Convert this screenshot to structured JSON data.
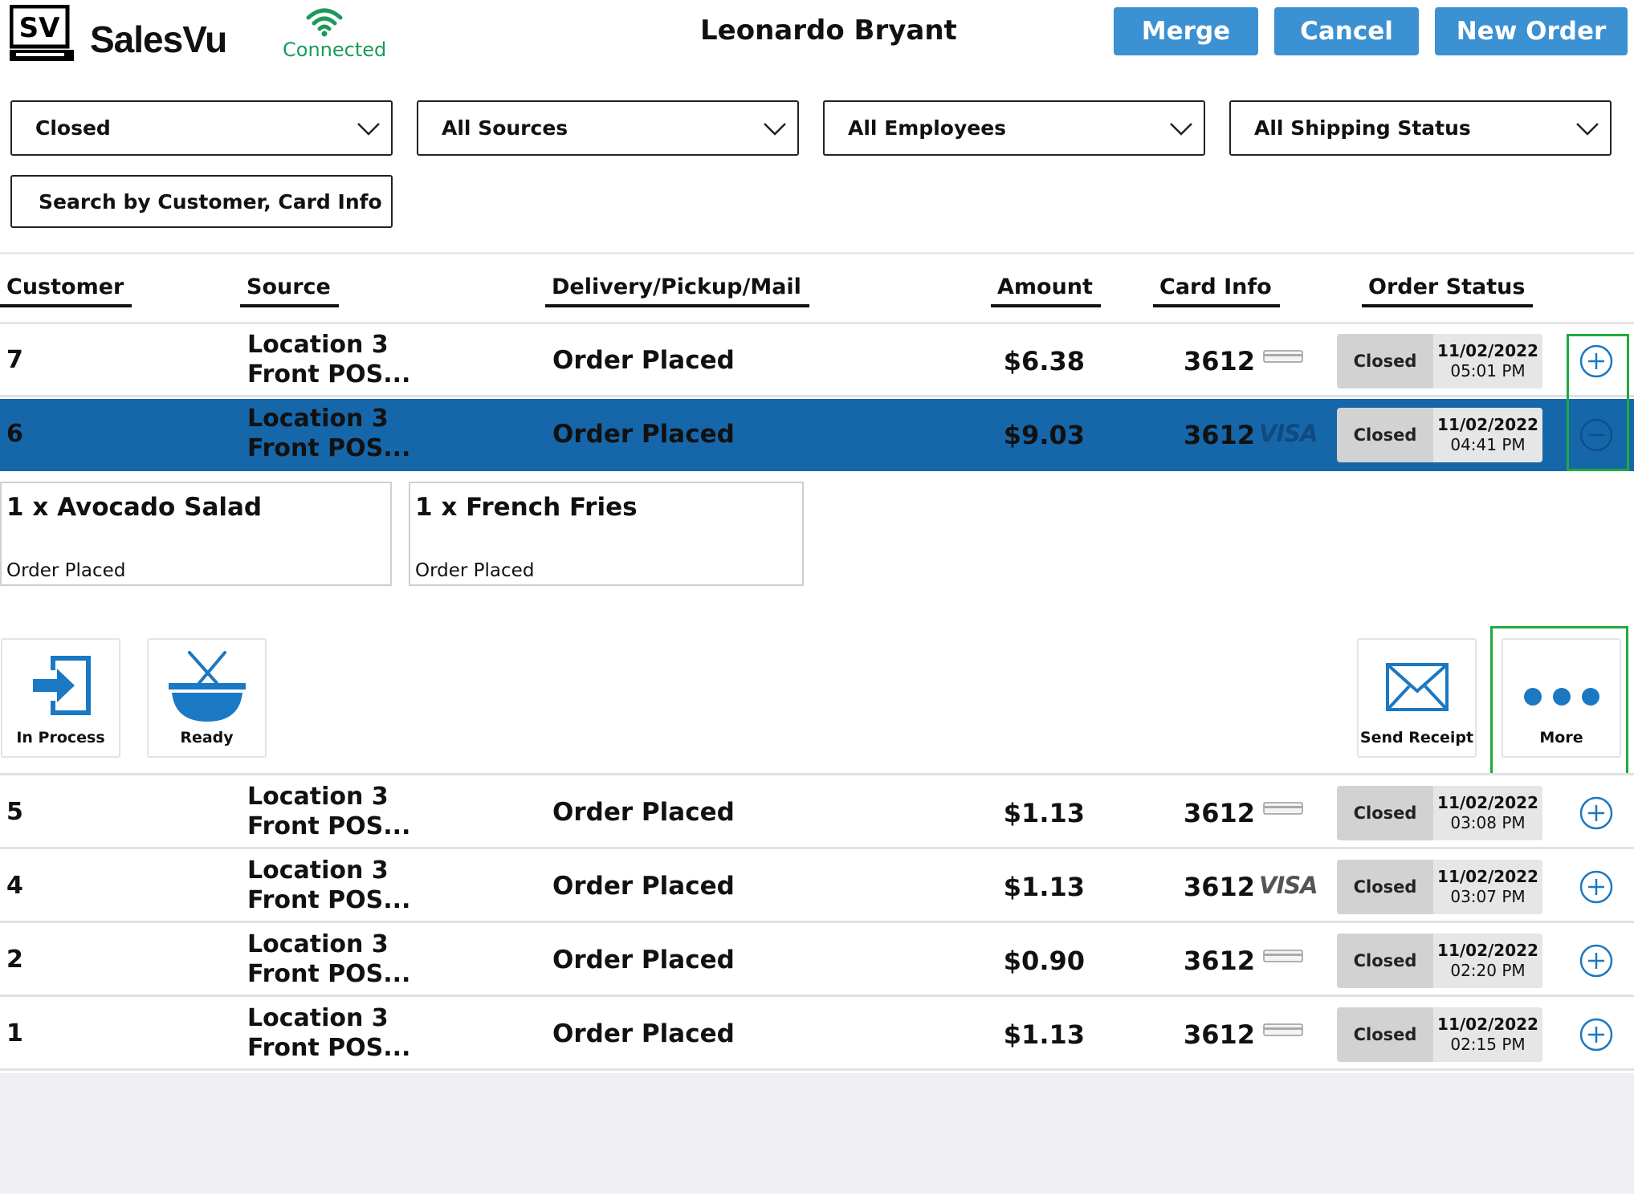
{
  "app": {
    "brand": "SalesVu",
    "logo_text": "SV",
    "connection_status": "Connected",
    "user_name": "Leonardo Bryant"
  },
  "header_buttons": {
    "merge": "Merge",
    "cancel": "Cancel",
    "new_order": "New Order"
  },
  "filters": {
    "status": "Closed",
    "sources": "All Sources",
    "employees": "All Employees",
    "shipping": "All Shipping Status",
    "search_placeholder": "Search by Customer, Card Info"
  },
  "columns": {
    "customer": "Customer",
    "source": "Source",
    "delivery": "Delivery/Pickup/Mail",
    "amount": "Amount",
    "card_info": "Card Info",
    "order_status": "Order Status"
  },
  "orders": [
    {
      "customer": "7",
      "source_line1": "Location 3",
      "source_line2": "Front POS...",
      "delivery": "Order Placed",
      "amount": "$6.38",
      "card": "3612",
      "card_type": "generic-card-icon",
      "status": "Closed",
      "date": "11/02/2022",
      "time": "05:01 PM",
      "expanded": false
    },
    {
      "customer": "6",
      "source_line1": "Location 3",
      "source_line2": "Front POS...",
      "delivery": "Order Placed",
      "amount": "$9.03",
      "card": "3612",
      "card_type": "VISA",
      "status": "Closed",
      "date": "11/02/2022",
      "time": "04:41 PM",
      "expanded": true
    },
    {
      "customer": "5",
      "source_line1": "Location 3",
      "source_line2": "Front POS...",
      "delivery": "Order Placed",
      "amount": "$1.13",
      "card": "3612",
      "card_type": "generic-card-icon",
      "status": "Closed",
      "date": "11/02/2022",
      "time": "03:08 PM",
      "expanded": false
    },
    {
      "customer": "4",
      "source_line1": "Location 3",
      "source_line2": "Front POS...",
      "delivery": "Order Placed",
      "amount": "$1.13",
      "card": "3612",
      "card_type": "VISA",
      "status": "Closed",
      "date": "11/02/2022",
      "time": "03:07 PM",
      "expanded": false
    },
    {
      "customer": "2",
      "source_line1": "Location 3",
      "source_line2": "Front POS...",
      "delivery": "Order Placed",
      "amount": "$0.90",
      "card": "3612",
      "card_type": "generic-card-icon",
      "status": "Closed",
      "date": "11/02/2022",
      "time": "02:20 PM",
      "expanded": false
    },
    {
      "customer": "1",
      "source_line1": "Location 3",
      "source_line2": "Front POS...",
      "delivery": "Order Placed",
      "amount": "$1.13",
      "card": "3612",
      "card_type": "generic-card-icon",
      "status": "Closed",
      "date": "11/02/2022",
      "time": "02:15 PM",
      "expanded": false
    }
  ],
  "expanded_items": [
    {
      "name": "1 x Avocado Salad",
      "status": "Order Placed"
    },
    {
      "name": "1 x French Fries",
      "status": "Order Placed"
    }
  ],
  "actions": {
    "in_process": "In Process",
    "ready": "Ready",
    "send_receipt": "Send Receipt",
    "more": "More"
  },
  "colors": {
    "accent": "#3b91d1",
    "selected_row": "#1667aa",
    "connected": "#1c9a5a",
    "highlight": "#1faa3e",
    "icon_blue": "#1b78c2"
  }
}
